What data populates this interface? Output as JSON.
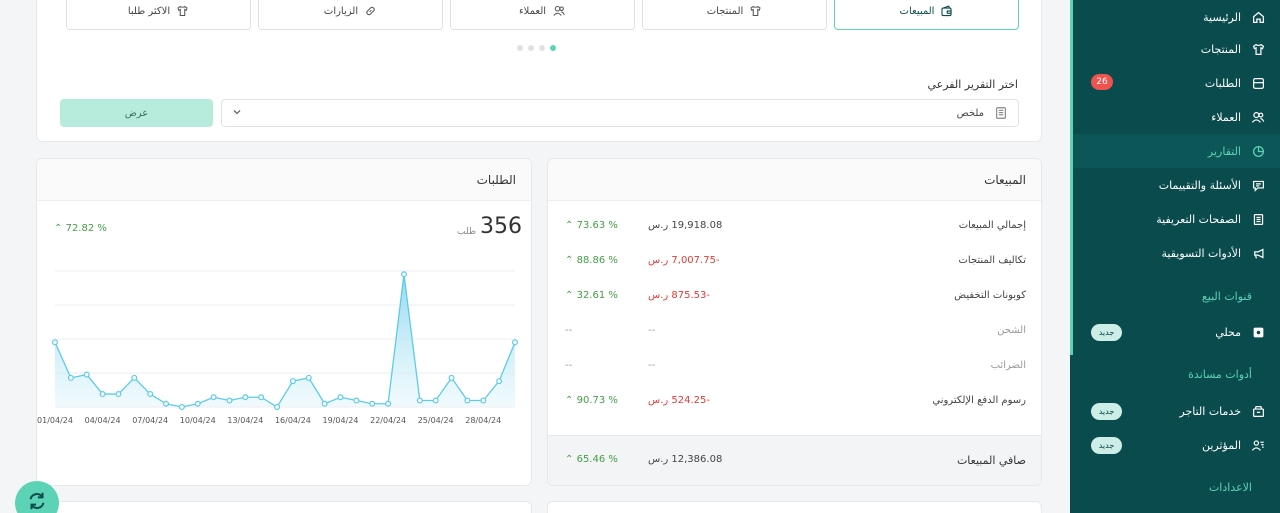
{
  "sidebar": {
    "items": [
      {
        "label": "الرئيسية",
        "icon": "home-icon"
      },
      {
        "label": "المنتجات",
        "icon": "shirt-icon"
      },
      {
        "label": "الطلبات",
        "icon": "box-icon",
        "badge": "26"
      },
      {
        "label": "العملاء",
        "icon": "users-icon"
      },
      {
        "label": "التقارير",
        "icon": "pie-chart-icon",
        "active": true
      },
      {
        "label": "الأسئلة والتقييمات",
        "icon": "chat-icon"
      },
      {
        "label": "الصفحات التعريفية",
        "icon": "document-icon"
      },
      {
        "label": "الأدوات التسويقية",
        "icon": "megaphone-icon"
      }
    ],
    "sales_channels_title": "قنوات البيع",
    "local": {
      "label": "محلي",
      "badge": "جديد"
    },
    "support_tools_title": "أدوات مساندة",
    "merchant_services": {
      "label": "خدمات التاجر",
      "badge": "جديد"
    },
    "influencers": {
      "label": "المؤثرين",
      "badge": "جديد"
    },
    "settings_title": "الاعدادات"
  },
  "tabs": [
    {
      "label": "المبيعات",
      "active": true
    },
    {
      "label": "المنتجات"
    },
    {
      "label": "العملاء"
    },
    {
      "label": "الزيارات"
    },
    {
      "label": "الاكثر طلبا"
    }
  ],
  "subreport": {
    "label": "اختر التقرير الفرعي",
    "selected": "ملخص",
    "show_button": "عرض"
  },
  "sales": {
    "title": "المبيعات",
    "rows": [
      {
        "label": "إجمالي المبيعات",
        "value": "19,918.08 ر.س",
        "pct": "73.63 %"
      },
      {
        "label": "تكاليف المنتجات",
        "value": "-7,007.75 ر.س",
        "pct": "88.86 %"
      },
      {
        "label": "كوبونات التخفيض",
        "value": "-875.53 ر.س",
        "pct": "32.61 %"
      },
      {
        "label": "الشحن",
        "value": "--",
        "pct": "--"
      },
      {
        "label": "الضرائب",
        "value": "--",
        "pct": "--"
      },
      {
        "label": "رسوم الدفع الإلكتروني",
        "value": "-524.25 ر.س",
        "pct": "90.73 %"
      }
    ],
    "net_label": "صافي المبيعات",
    "net_value": "12,386.08 ر.س",
    "net_pct": "65.46 %"
  },
  "orders": {
    "title": "الطلبات",
    "count": "356",
    "unit": "طلب",
    "pct": "72.82 %"
  },
  "colors": {
    "accent": "#5dd3b6",
    "sidebar": "#0a4b4d",
    "positive": "#43a047",
    "negative": "#e53935",
    "badge": "#ef5350"
  },
  "chart_data": {
    "type": "area",
    "x_tick_labels": [
      "01/04/24",
      "04/04/24",
      "07/04/24",
      "10/04/24",
      "13/04/24",
      "16/04/24",
      "19/04/24",
      "22/04/24",
      "25/04/24",
      "28/04/24"
    ],
    "values": [
      20,
      9,
      10,
      4,
      4,
      9,
      4,
      1,
      0,
      1,
      3,
      2,
      3,
      3,
      0,
      8,
      9,
      1,
      3,
      2,
      1,
      1,
      41,
      2,
      2,
      9,
      2,
      2,
      8,
      20
    ],
    "ylim": [
      0,
      42
    ],
    "grid": true
  }
}
